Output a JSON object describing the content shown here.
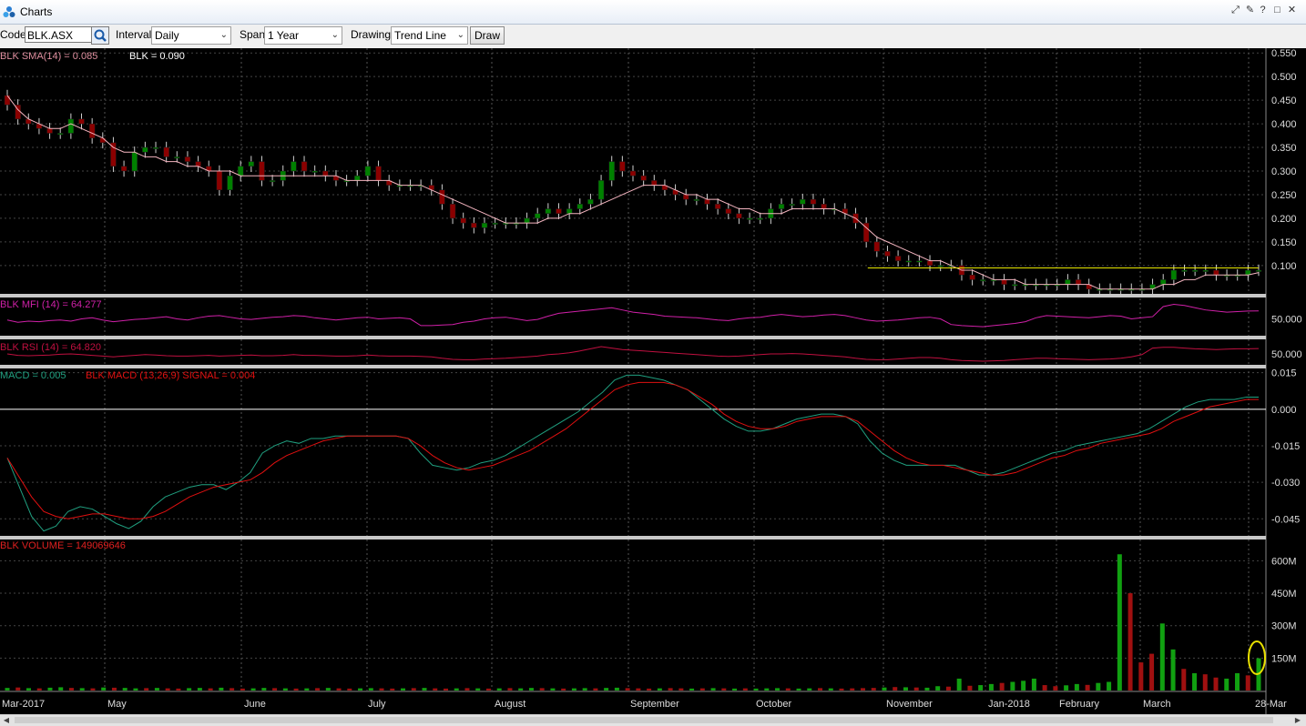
{
  "window": {
    "title": "Charts"
  },
  "toolbar": {
    "code_label": "Code",
    "code_value": "BLK.ASX",
    "interval_label": "Interval",
    "interval_value": "Daily",
    "span_label": "Span",
    "span_value": "1 Year",
    "drawing_label": "Drawing",
    "drawing_value": "Trend Line",
    "draw_button": "Draw"
  },
  "colors": {
    "background": "#000000",
    "up_candle": "#008000",
    "down_candle": "#8b0000",
    "sma": "#f5b5c0",
    "trend_line": "#e6e600",
    "mfi": "#d020a8",
    "rsi": "#c01040",
    "macd": "#20a080",
    "signal": "#e01010",
    "highlight_circle": "#e8e000"
  },
  "chart_data": [
    {
      "type": "candlestick",
      "panel": "price",
      "legend": [
        "BLK SMA(14) = 0.085",
        "BLK = 0.090"
      ],
      "y_ticks": [
        "0.550",
        "0.500",
        "0.450",
        "0.400",
        "0.350",
        "0.300",
        "0.250",
        "0.200",
        "0.150",
        "0.100"
      ],
      "ylim": [
        0.04,
        0.56
      ],
      "close": [
        0.44,
        0.41,
        0.4,
        0.39,
        0.38,
        0.38,
        0.41,
        0.4,
        0.37,
        0.36,
        0.31,
        0.3,
        0.34,
        0.35,
        0.35,
        0.33,
        0.33,
        0.32,
        0.31,
        0.3,
        0.26,
        0.29,
        0.31,
        0.32,
        0.28,
        0.28,
        0.3,
        0.32,
        0.3,
        0.3,
        0.29,
        0.28,
        0.28,
        0.29,
        0.31,
        0.28,
        0.27,
        0.27,
        0.27,
        0.27,
        0.26,
        0.23,
        0.2,
        0.19,
        0.18,
        0.19,
        0.19,
        0.19,
        0.19,
        0.2,
        0.21,
        0.22,
        0.21,
        0.22,
        0.23,
        0.24,
        0.28,
        0.32,
        0.3,
        0.29,
        0.28,
        0.27,
        0.26,
        0.25,
        0.24,
        0.24,
        0.23,
        0.22,
        0.21,
        0.2,
        0.2,
        0.2,
        0.22,
        0.23,
        0.23,
        0.24,
        0.23,
        0.22,
        0.22,
        0.21,
        0.19,
        0.15,
        0.13,
        0.12,
        0.11,
        0.11,
        0.11,
        0.1,
        0.1,
        0.1,
        0.08,
        0.07,
        0.07,
        0.07,
        0.06,
        0.06,
        0.06,
        0.06,
        0.06,
        0.06,
        0.07,
        0.06,
        0.05,
        0.05,
        0.05,
        0.05,
        0.05,
        0.05,
        0.06,
        0.07,
        0.09,
        0.09,
        0.09,
        0.09,
        0.08,
        0.08,
        0.08,
        0.09,
        0.09
      ],
      "sma14": [
        0.46,
        0.43,
        0.41,
        0.4,
        0.39,
        0.39,
        0.4,
        0.39,
        0.38,
        0.37,
        0.35,
        0.34,
        0.34,
        0.33,
        0.33,
        0.32,
        0.32,
        0.31,
        0.31,
        0.3,
        0.3,
        0.3,
        0.29,
        0.29,
        0.29,
        0.29,
        0.29,
        0.29,
        0.29,
        0.29,
        0.29,
        0.29,
        0.28,
        0.28,
        0.28,
        0.28,
        0.28,
        0.27,
        0.27,
        0.27,
        0.26,
        0.25,
        0.24,
        0.23,
        0.22,
        0.21,
        0.2,
        0.19,
        0.19,
        0.19,
        0.19,
        0.2,
        0.2,
        0.21,
        0.21,
        0.22,
        0.23,
        0.24,
        0.25,
        0.26,
        0.27,
        0.27,
        0.27,
        0.26,
        0.25,
        0.25,
        0.24,
        0.24,
        0.23,
        0.22,
        0.22,
        0.21,
        0.21,
        0.21,
        0.22,
        0.22,
        0.22,
        0.22,
        0.22,
        0.21,
        0.2,
        0.18,
        0.16,
        0.15,
        0.14,
        0.13,
        0.12,
        0.11,
        0.11,
        0.1,
        0.09,
        0.09,
        0.08,
        0.07,
        0.07,
        0.07,
        0.06,
        0.06,
        0.06,
        0.06,
        0.06,
        0.06,
        0.06,
        0.05,
        0.05,
        0.05,
        0.05,
        0.05,
        0.05,
        0.06,
        0.06,
        0.07,
        0.07,
        0.08,
        0.08,
        0.08,
        0.08,
        0.08,
        0.085
      ],
      "trend_line": {
        "y": 0.095,
        "from_index": 82,
        "to_index": 118
      }
    },
    {
      "type": "line",
      "panel": "mfi",
      "legend": [
        "BLK MFI (14) = 64.277"
      ],
      "y_ticks": [
        "50.000"
      ],
      "ylim": [
        20,
        85
      ],
      "values": [
        48,
        44,
        46,
        45,
        47,
        48,
        46,
        50,
        52,
        48,
        45,
        47,
        49,
        50,
        52,
        54,
        50,
        48,
        52,
        55,
        56,
        53,
        50,
        49,
        51,
        53,
        54,
        56,
        55,
        52,
        50,
        48,
        50,
        52,
        53,
        50,
        51,
        52,
        50,
        38,
        38,
        39,
        40,
        44,
        46,
        50,
        52,
        53,
        50,
        47,
        49,
        55,
        60,
        62,
        64,
        66,
        68,
        70,
        66,
        62,
        60,
        58,
        55,
        54,
        53,
        52,
        50,
        48,
        47,
        50,
        52,
        53,
        56,
        58,
        56,
        54,
        55,
        57,
        58,
        56,
        52,
        48,
        46,
        47,
        48,
        50,
        52,
        53,
        50,
        40,
        38,
        37,
        36,
        38,
        40,
        42,
        45,
        52,
        56,
        55,
        54,
        53,
        52,
        54,
        56,
        55,
        50,
        52,
        54,
        72,
        76,
        74,
        70,
        66,
        64,
        62,
        63,
        64,
        64.277
      ]
    },
    {
      "type": "line",
      "panel": "rsi",
      "legend": [
        "BLK RSI (14) = 64.820"
      ],
      "y_ticks": [
        "50.000"
      ],
      "ylim": [
        20,
        85
      ],
      "values": [
        50,
        46,
        45,
        46,
        47,
        49,
        50,
        48,
        46,
        44,
        42,
        44,
        46,
        48,
        47,
        45,
        44,
        44,
        45,
        46,
        44,
        45,
        46,
        47,
        45,
        45,
        46,
        48,
        46,
        46,
        45,
        44,
        44,
        45,
        47,
        45,
        44,
        44,
        44,
        43,
        42,
        38,
        35,
        34,
        34,
        36,
        37,
        38,
        40,
        42,
        44,
        48,
        50,
        53,
        58,
        64,
        70,
        66,
        62,
        60,
        58,
        56,
        54,
        52,
        50,
        48,
        46,
        44,
        43,
        44,
        46,
        48,
        50,
        50,
        51,
        50,
        48,
        46,
        44,
        42,
        38,
        35,
        34,
        34,
        36,
        38,
        40,
        40,
        38,
        34,
        32,
        31,
        30,
        31,
        32,
        34,
        36,
        38,
        38,
        37,
        36,
        35,
        34,
        35,
        36,
        38,
        42,
        48,
        66,
        68,
        68,
        66,
        64,
        63,
        62,
        63,
        64,
        64,
        64.82
      ]
    },
    {
      "type": "line",
      "panel": "macd",
      "legend": [
        "MACD = 0.005",
        "BLK MACD (13,26,9) SIGNAL = 0.004"
      ],
      "y_ticks": [
        "0.015",
        "0.000",
        "-0.015",
        "-0.030",
        "-0.045"
      ],
      "ylim": [
        -0.052,
        0.016
      ],
      "macd": [
        -0.02,
        -0.032,
        -0.044,
        -0.05,
        -0.048,
        -0.042,
        -0.04,
        -0.041,
        -0.044,
        -0.047,
        -0.049,
        -0.046,
        -0.04,
        -0.036,
        -0.034,
        -0.032,
        -0.031,
        -0.031,
        -0.033,
        -0.03,
        -0.026,
        -0.018,
        -0.015,
        -0.013,
        -0.014,
        -0.012,
        -0.012,
        -0.011,
        -0.011,
        -0.011,
        -0.011,
        -0.011,
        -0.011,
        -0.012,
        -0.018,
        -0.023,
        -0.024,
        -0.025,
        -0.024,
        -0.022,
        -0.021,
        -0.019,
        -0.016,
        -0.013,
        -0.01,
        -0.007,
        -0.004,
        -0.001,
        0.003,
        0.007,
        0.012,
        0.014,
        0.014,
        0.013,
        0.012,
        0.01,
        0.008,
        0.004,
        0.0,
        -0.004,
        -0.007,
        -0.009,
        -0.009,
        -0.008,
        -0.006,
        -0.004,
        -0.003,
        -0.002,
        -0.002,
        -0.003,
        -0.006,
        -0.013,
        -0.018,
        -0.021,
        -0.023,
        -0.023,
        -0.023,
        -0.023,
        -0.023,
        -0.025,
        -0.027,
        -0.027,
        -0.026,
        -0.024,
        -0.022,
        -0.02,
        -0.018,
        -0.017,
        -0.015,
        -0.014,
        -0.013,
        -0.012,
        -0.011,
        -0.01,
        -0.008,
        -0.005,
        -0.002,
        0.001,
        0.003,
        0.004,
        0.004,
        0.004,
        0.005,
        0.005
      ],
      "signal": [
        -0.02,
        -0.028,
        -0.036,
        -0.042,
        -0.044,
        -0.045,
        -0.044,
        -0.043,
        -0.043,
        -0.044,
        -0.045,
        -0.045,
        -0.044,
        -0.042,
        -0.039,
        -0.036,
        -0.034,
        -0.032,
        -0.031,
        -0.03,
        -0.029,
        -0.026,
        -0.022,
        -0.019,
        -0.017,
        -0.015,
        -0.013,
        -0.012,
        -0.011,
        -0.011,
        -0.011,
        -0.011,
        -0.011,
        -0.012,
        -0.015,
        -0.019,
        -0.022,
        -0.024,
        -0.025,
        -0.024,
        -0.023,
        -0.021,
        -0.019,
        -0.017,
        -0.014,
        -0.011,
        -0.008,
        -0.004,
        0.0,
        0.004,
        0.008,
        0.01,
        0.011,
        0.011,
        0.011,
        0.01,
        0.008,
        0.005,
        0.002,
        -0.002,
        -0.005,
        -0.007,
        -0.008,
        -0.008,
        -0.007,
        -0.005,
        -0.004,
        -0.003,
        -0.003,
        -0.003,
        -0.005,
        -0.009,
        -0.013,
        -0.017,
        -0.02,
        -0.022,
        -0.023,
        -0.023,
        -0.024,
        -0.025,
        -0.026,
        -0.027,
        -0.027,
        -0.026,
        -0.024,
        -0.022,
        -0.02,
        -0.019,
        -0.017,
        -0.016,
        -0.014,
        -0.013,
        -0.012,
        -0.011,
        -0.01,
        -0.008,
        -0.005,
        -0.003,
        -0.001,
        0.001,
        0.002,
        0.003,
        0.004,
        0.004
      ]
    },
    {
      "type": "bar",
      "panel": "volume",
      "legend": [
        "BLK VOLUME = 149069646"
      ],
      "y_ticks": [
        "600M",
        "450M",
        "300M",
        "150M"
      ],
      "ylim": [
        0,
        690000000
      ],
      "values_millions": [
        12,
        14,
        11,
        10,
        13,
        15,
        12,
        11,
        10,
        14,
        13,
        12,
        10,
        11,
        12,
        10,
        9,
        11,
        12,
        10,
        13,
        11,
        9,
        10,
        12,
        11,
        10,
        9,
        10,
        11,
        12,
        10,
        9,
        10,
        11,
        10,
        9,
        10,
        11,
        12,
        10,
        9,
        10,
        11,
        10,
        9,
        10,
        11,
        10,
        12,
        11,
        10,
        9,
        10,
        11,
        10,
        12,
        13,
        11,
        10,
        9,
        10,
        11,
        10,
        9,
        10,
        11,
        10,
        9,
        10,
        9,
        10,
        11,
        10,
        9,
        10,
        11,
        10,
        9,
        10,
        11,
        12,
        14,
        16,
        15,
        14,
        13,
        20,
        18,
        55,
        22,
        25,
        30,
        35,
        40,
        45,
        55,
        25,
        20,
        24,
        30,
        26,
        35,
        40,
        630,
        450,
        130,
        170,
        310,
        190,
        100,
        80,
        75,
        60,
        55,
        80,
        70,
        149.069646
      ],
      "up_flags": [
        1,
        0,
        1,
        0,
        1,
        1,
        0,
        1,
        0,
        1,
        0,
        1,
        1,
        0,
        1,
        0,
        0,
        1,
        1,
        0,
        1,
        0,
        0,
        1,
        1,
        0,
        1,
        0,
        1,
        0,
        1,
        0,
        0,
        1,
        1,
        0,
        0,
        1,
        0,
        1,
        0,
        0,
        1,
        0,
        1,
        0,
        1,
        0,
        1,
        1,
        0,
        1,
        0,
        1,
        1,
        0,
        1,
        1,
        0,
        0,
        0,
        1,
        0,
        0,
        1,
        0,
        1,
        0,
        1,
        0,
        1,
        1,
        1,
        0,
        1,
        1,
        0,
        1,
        0,
        0,
        0,
        0,
        1,
        0,
        1,
        0,
        1,
        1,
        0,
        1,
        0,
        1,
        1,
        0,
        1,
        1,
        1,
        0,
        0,
        1,
        1,
        0,
        1,
        1,
        1,
        0,
        0,
        0,
        1,
        1,
        0,
        1,
        0,
        0,
        1,
        1,
        0,
        1
      ]
    }
  ],
  "x_axis": {
    "labels": [
      "Mar-2017",
      "May",
      "June",
      "July",
      "August",
      "September",
      "October",
      "November",
      "Jan-2018",
      "February",
      "March",
      "28-Mar"
    ]
  }
}
